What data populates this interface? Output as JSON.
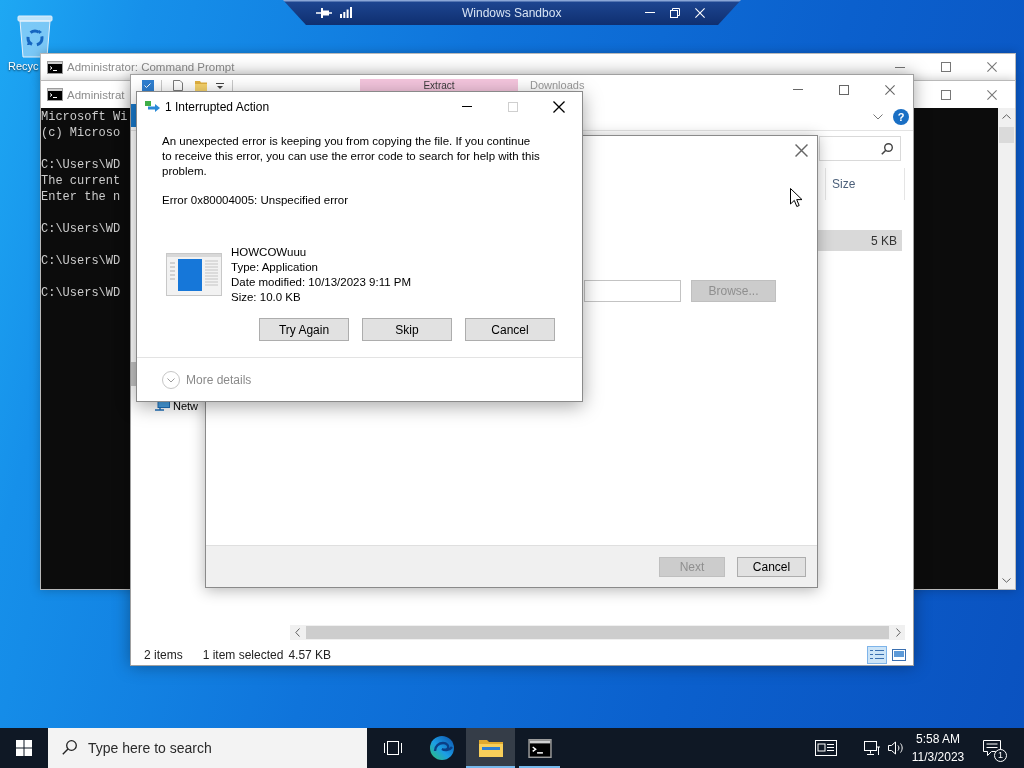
{
  "desktop_icons": [
    {
      "label": "Recyc"
    }
  ],
  "cmd_windows": [
    {
      "title": "Administrator: Command Prompt"
    },
    {
      "title": "Administrat",
      "blocks": [
        [
          "Microsoft Wi",
          "(c) Microso"
        ],
        [
          "C:\\Users\\WD",
          "The current",
          "Enter the n"
        ],
        [
          "C:\\Users\\WD"
        ],
        [
          "C:\\Users\\WD"
        ],
        [
          "C:\\Users\\WD"
        ]
      ]
    }
  ],
  "explorer": {
    "context_tab": "Extract",
    "title": "Downloads",
    "help": "?",
    "nav_items": [
      {
        "label": "Netw"
      }
    ],
    "columns": [
      "Size"
    ],
    "rows": [
      {
        "size": "5 KB",
        "selected": true
      }
    ],
    "status_bar": [
      "2 items",
      "1 item selected",
      "4.57 KB"
    ],
    "views": [
      {
        "kind": "details",
        "selected": true
      },
      {
        "kind": "large-icons",
        "selected": false
      }
    ]
  },
  "wizard": {
    "browse": {
      "label": "Browse...",
      "disabled": true
    },
    "buttons": [
      {
        "label": "Next",
        "disabled": true
      },
      {
        "label": "Cancel",
        "disabled": false
      }
    ]
  },
  "dialog": {
    "title": "1 Interrupted Action",
    "maximize_disabled": true,
    "message": "An unexpected error is keeping you from copying the file. If you continue to receive this error, you can use the error code to search for help with this problem.",
    "error": "Error 0x80004005: Unspecified error",
    "file": {
      "name": "HOWCOWuuu",
      "type": "Type: Application",
      "modified": "Date modified: 10/13/2023 9:11 PM",
      "size": "Size: 10.0 KB"
    },
    "buttons": [
      "Try Again",
      "Skip",
      "Cancel"
    ],
    "details_toggle": "More details"
  },
  "sandbox_bar": {
    "title": "Windows Sandbox"
  },
  "taskbar": {
    "search": {
      "placeholder": "Type here to search"
    },
    "apps": [
      {
        "kind": "task-view",
        "selected": false,
        "running": false
      },
      {
        "kind": "browser",
        "selected": false,
        "running": false
      },
      {
        "kind": "folder",
        "selected": true,
        "running": true
      },
      {
        "kind": "console",
        "selected": false,
        "running": true
      }
    ],
    "clock": {
      "time": "5:58 AM",
      "date": "11/3/2023"
    },
    "notifications": "1"
  }
}
